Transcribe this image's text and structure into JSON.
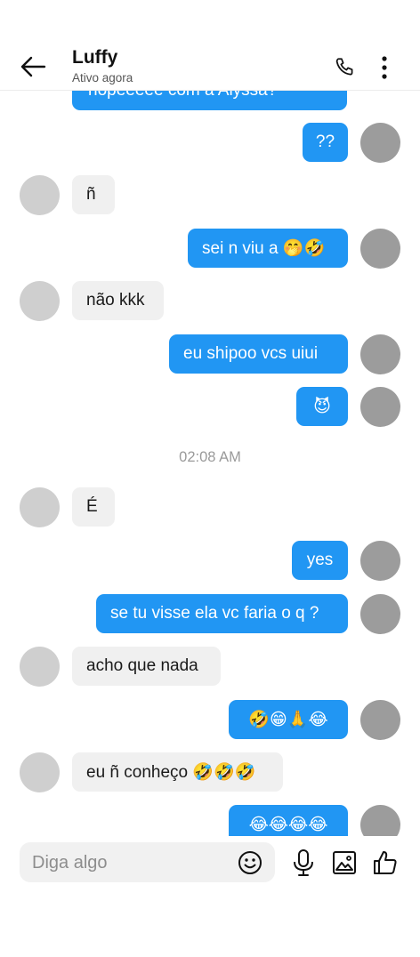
{
  "header": {
    "title": "Luffy",
    "status": "Ativo agora"
  },
  "timestamp": "02:08 AM",
  "messages": [
    {
      "side": "out",
      "text": "hopeeeee com a Alyssa?"
    },
    {
      "side": "out",
      "text": "??"
    },
    {
      "side": "in",
      "text": "ñ"
    },
    {
      "side": "out",
      "text": "sei n viu a 🤭🤣"
    },
    {
      "side": "in",
      "text": "não kkk"
    },
    {
      "side": "out",
      "text": "eu shipoo vcs uiui"
    },
    {
      "side": "out",
      "text": "😈"
    },
    {
      "side": "in",
      "text": "É"
    },
    {
      "side": "out",
      "text": "yes"
    },
    {
      "side": "out",
      "text": "se tu visse ela vc faria o q ?"
    },
    {
      "side": "in",
      "text": "acho que nada"
    },
    {
      "side": "out",
      "text": "🤣😁🙏😂"
    },
    {
      "side": "in",
      "text": "eu ñ conheço 🤣🤣🤣"
    },
    {
      "side": "out",
      "text": "😂😂😂😂"
    }
  ],
  "composer": {
    "placeholder": "Diga algo"
  },
  "icons": {
    "back": "back-arrow-icon",
    "call": "phone-icon",
    "menu": "more-vertical-icon",
    "emoji": "smiley-icon",
    "mic": "microphone-icon",
    "image": "image-icon",
    "like": "thumbs-up-icon"
  },
  "colors": {
    "outgoing_bubble": "#2196f3",
    "incoming_bubble": "#f0f0f0"
  }
}
